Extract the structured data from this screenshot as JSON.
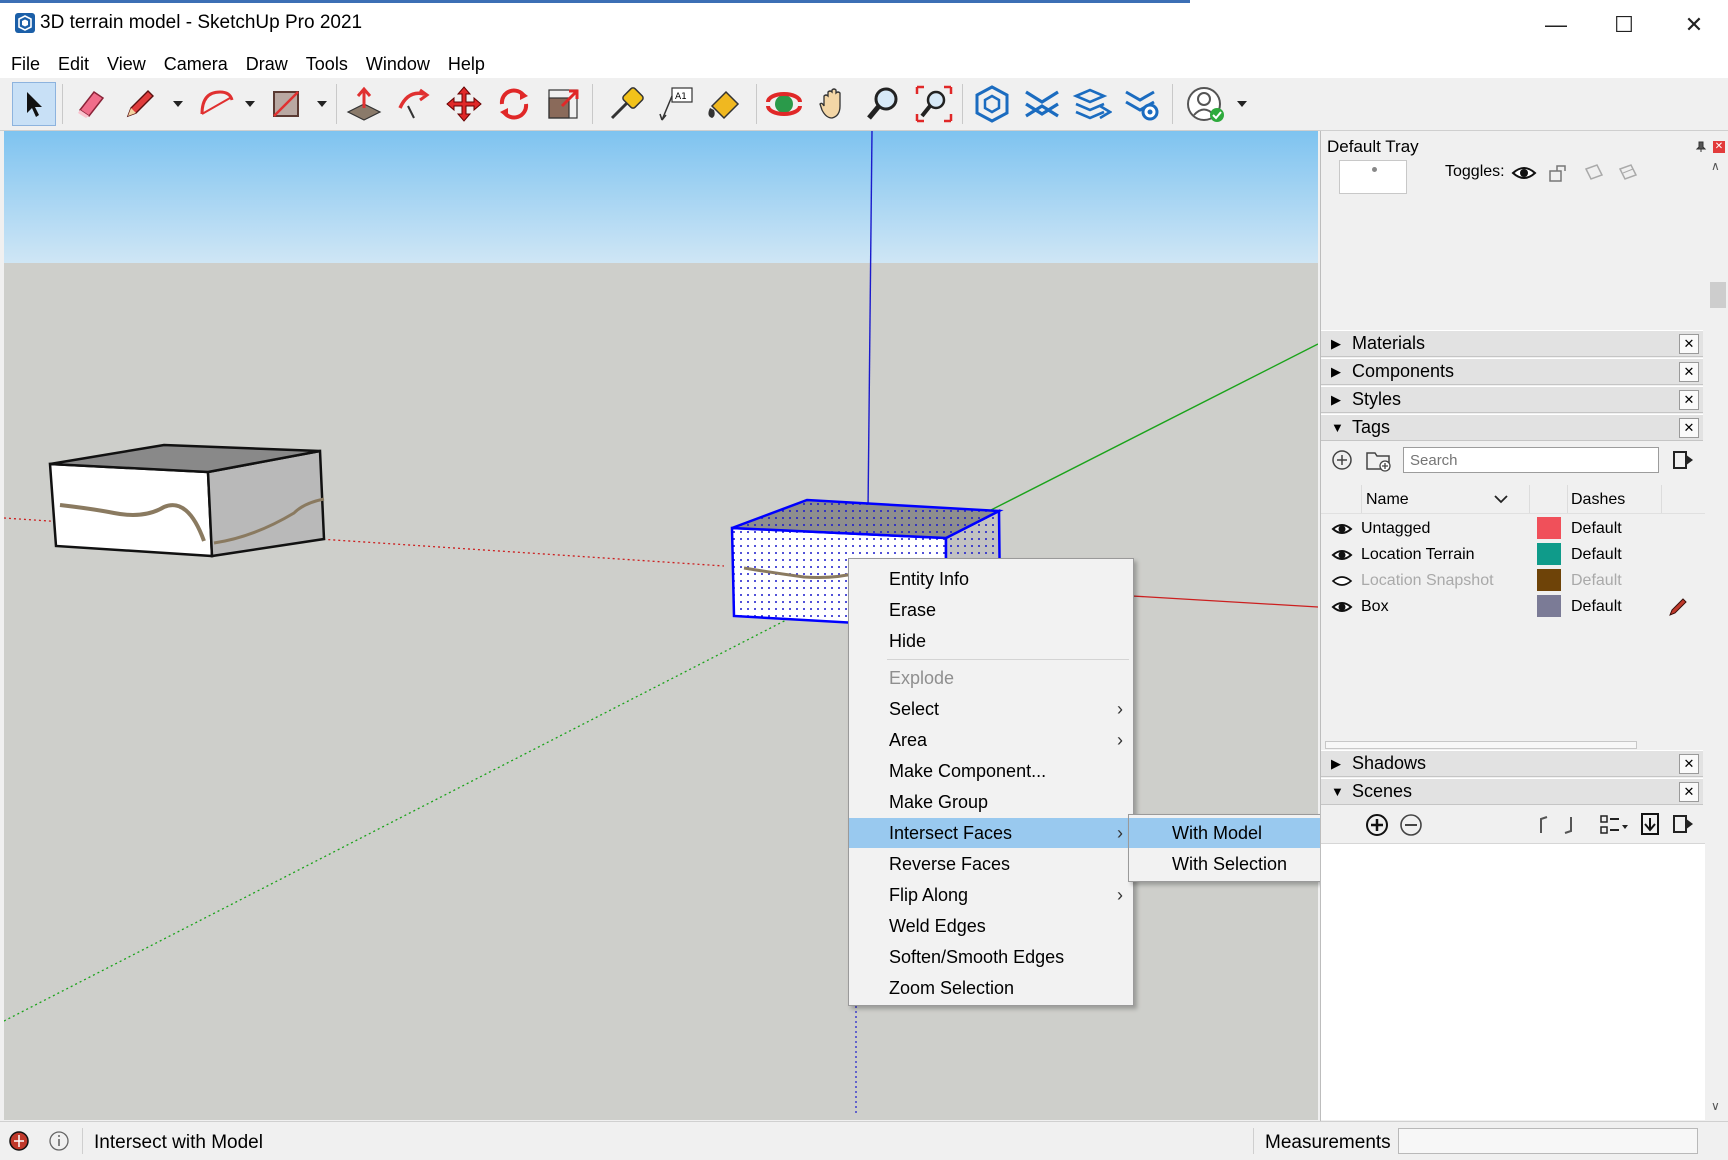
{
  "window": {
    "title": "3D terrain model - SketchUp Pro 2021",
    "minimize": "—",
    "maximize": "☐",
    "close": "✕"
  },
  "menu": [
    "File",
    "Edit",
    "View",
    "Camera",
    "Draw",
    "Tools",
    "Window",
    "Help"
  ],
  "toolbar": {
    "tools": [
      "select",
      "eraser",
      "pencil-line",
      "arc",
      "rectangle",
      "push-pull",
      "follow-me",
      "move",
      "rotate",
      "scale",
      "tape-measure",
      "text",
      "paint-bucket",
      "orbit",
      "pan",
      "zoom",
      "zoom-extents",
      "3d-warehouse",
      "extension-warehouse",
      "layout",
      "extension-manager",
      "account"
    ]
  },
  "context_menu": {
    "items": [
      {
        "label": "Entity Info"
      },
      {
        "label": "Erase"
      },
      {
        "label": "Hide"
      },
      {
        "label": "Explode",
        "disabled": true
      },
      {
        "label": "Select",
        "submenu": true
      },
      {
        "label": "Area",
        "submenu": true
      },
      {
        "label": "Make Component..."
      },
      {
        "label": "Make Group"
      },
      {
        "label": "Intersect Faces",
        "submenu": true,
        "highlighted": true
      },
      {
        "label": "Reverse Faces"
      },
      {
        "label": "Flip Along",
        "submenu": true
      },
      {
        "label": "Weld Edges"
      },
      {
        "label": "Soften/Smooth Edges"
      },
      {
        "label": "Zoom Selection"
      }
    ],
    "submenu": [
      {
        "label": "With Model",
        "highlighted": true
      },
      {
        "label": "With Selection"
      }
    ]
  },
  "tray": {
    "title": "Default Tray",
    "toggles_label": "Toggles:",
    "panels_top": [
      {
        "label": "Materials",
        "expanded": false
      },
      {
        "label": "Components",
        "expanded": false
      },
      {
        "label": "Styles",
        "expanded": false
      },
      {
        "label": "Tags",
        "expanded": true
      }
    ],
    "tags": {
      "search_placeholder": "Search",
      "col_name": "Name",
      "col_dashes": "Dashes",
      "rows": [
        {
          "name": "Untagged",
          "color": "#f0505a",
          "dashes": "Default",
          "visible": true
        },
        {
          "name": "Location Terrain",
          "color": "#0f9b8a",
          "dashes": "Default",
          "visible": true
        },
        {
          "name": "Location Snapshot",
          "color": "#6e4308",
          "dashes": "Default",
          "visible": false
        },
        {
          "name": "Box",
          "color": "#7b7b96",
          "dashes": "Default",
          "visible": true
        }
      ]
    },
    "panels_bottom": [
      {
        "label": "Shadows",
        "expanded": false
      },
      {
        "label": "Scenes",
        "expanded": true
      }
    ]
  },
  "status": {
    "text": "Intersect with Model",
    "measurements_label": "Measurements",
    "measurements_value": ""
  },
  "colors": {
    "menu_highlight": "#99c9ef",
    "axis_red": "#cc1f1f",
    "axis_green": "#1aa31a",
    "axis_blue": "#1a1acc",
    "selection_blue": "#0000ff"
  }
}
